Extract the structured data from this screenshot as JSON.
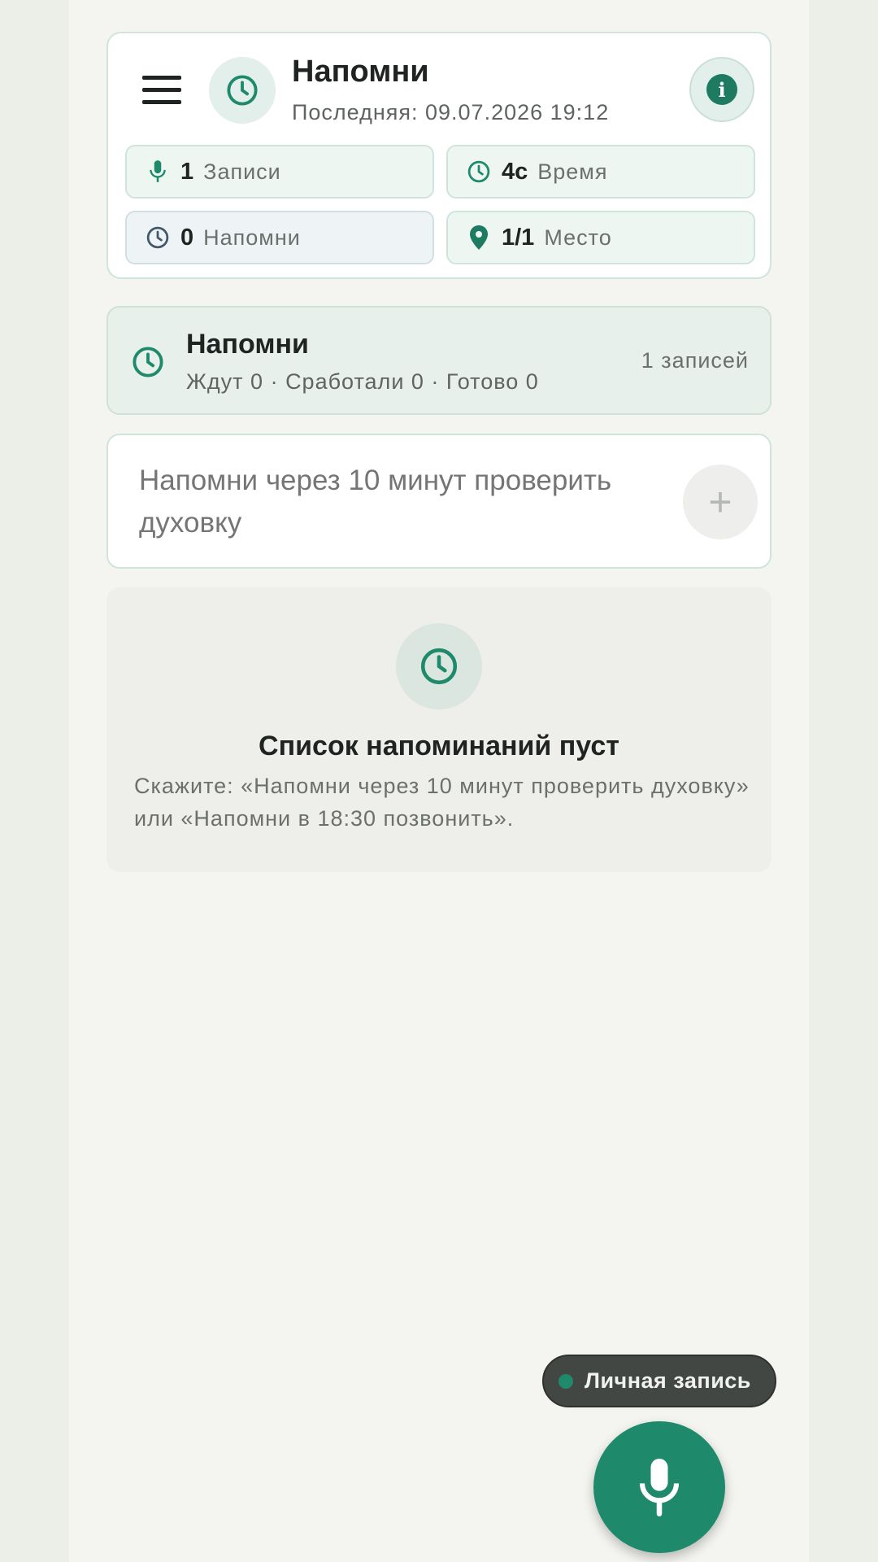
{
  "header": {
    "title": "Напомни",
    "subtitle": "Последняя: 09.07.2026 19:12",
    "menu_icon": "hamburger-menu-icon",
    "app_icon": "clock-icon",
    "info_icon": "info-icon",
    "info_glyph": "i"
  },
  "stats": [
    {
      "icon": "mic-icon",
      "value": "1",
      "label": "Записи"
    },
    {
      "icon": "clock-icon",
      "value": "4с",
      "label": "Время"
    },
    {
      "icon": "clock-icon",
      "value": "0",
      "label": "Напомни"
    },
    {
      "icon": "location-pin-icon",
      "value": "1/1",
      "label": "Место"
    }
  ],
  "summary": {
    "title": "Напомни",
    "subtitle": "Ждут 0 · Сработали 0 · Готово 0",
    "count": "1 записей"
  },
  "input": {
    "placeholder": "Напомни через 10 минут проверить духовку",
    "add_glyph": "+"
  },
  "empty_state": {
    "title": "Список напоминаний пуст",
    "text": "Скажите: «Напомни через 10 минут проверить духовку» или «Напомни в 18:30 позвонить»."
  },
  "badge": {
    "label": "Личная запись"
  },
  "colors": {
    "accent": "#1e8a6b",
    "accent_dark": "#1e7b62",
    "background": "#f4f5f0"
  }
}
